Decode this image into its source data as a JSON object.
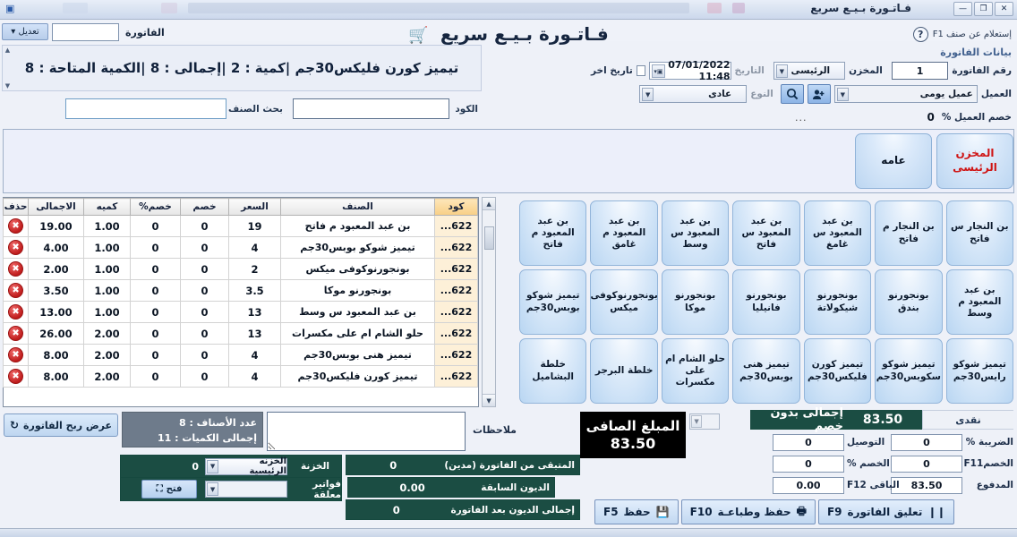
{
  "window": {
    "title": "فـاتـورة بـيـع سريع",
    "minimize": "—",
    "maximize": "❐",
    "close": "✕"
  },
  "topbar": {
    "invoice_label": "الفاتورة",
    "invoice_value": "",
    "edit_button": "تعديل ▾"
  },
  "header": {
    "help_label": "إستعلام عن صنف F1",
    "help_icon": "?",
    "section_title": "بيانات الفاتورة",
    "invoice_no_label": "رقم الفاتورة",
    "invoice_no_value": "1",
    "store_label": "المخزن",
    "store_value": "الرئيسى",
    "date_label": "التاريخ",
    "date_value": "07/01/2022 11:48",
    "other_date_label": "تاريخ اخر",
    "other_date_checked": false,
    "customer_label": "العميل",
    "customer_value": "عميل يومى",
    "customer_search_icon": "search-icon",
    "customer_add_icon": "add-user-icon",
    "type_label": "النوع",
    "type_value": "عادى",
    "customer_discount_label": "خصم العميل %",
    "customer_discount_value": "0",
    "dots": "..."
  },
  "item_banner": {
    "text": "تيميز كورن فليكس30جم  |كمية : 2  |إجمالى : 8  |الكمية المتاحة : 8"
  },
  "search_row": {
    "code_label": "الكود",
    "code_value": "",
    "search_label": "بحث الصنف",
    "search_value": ""
  },
  "category_tabs": [
    {
      "label": "عامه",
      "accent": "#0b1626"
    },
    {
      "label": "المخزن الرئيسى",
      "accent": "#cf1414"
    }
  ],
  "items_table": {
    "columns": [
      "كود",
      "الصنف",
      "السعر",
      "خصم",
      "خصم%",
      "كميه",
      "الاجمالى",
      "حذف"
    ],
    "delete_glyph": "✖",
    "rows": [
      {
        "code": "622...",
        "name": "بن عبد المعبود م فاتح",
        "price": "19",
        "disc": "0",
        "disc_pct": "0",
        "qty": "1.00",
        "total": "19.00"
      },
      {
        "code": "622...",
        "name": "تيميز شوكو بوبس30جم",
        "price": "4",
        "disc": "0",
        "disc_pct": "0",
        "qty": "1.00",
        "total": "4.00"
      },
      {
        "code": "622...",
        "name": "بونجورنوكوفى ميكس",
        "price": "2",
        "disc": "0",
        "disc_pct": "0",
        "qty": "1.00",
        "total": "2.00"
      },
      {
        "code": "622...",
        "name": "بونجورنو موكا",
        "price": "3.5",
        "disc": "0",
        "disc_pct": "0",
        "qty": "1.00",
        "total": "3.50"
      },
      {
        "code": "622...",
        "name": "بن عبد المعبود س وسط",
        "price": "13",
        "disc": "0",
        "disc_pct": "0",
        "qty": "1.00",
        "total": "13.00"
      },
      {
        "code": "622...",
        "name": "حلو الشام ام على مكسرات",
        "price": "13",
        "disc": "0",
        "disc_pct": "0",
        "qty": "2.00",
        "total": "26.00"
      },
      {
        "code": "622...",
        "name": "تيميز هنى بوبس30جم",
        "price": "4",
        "disc": "0",
        "disc_pct": "0",
        "qty": "2.00",
        "total": "8.00"
      },
      {
        "code": "622...",
        "name": "تيميز كورن فليكس30جم",
        "price": "4",
        "disc": "0",
        "disc_pct": "0",
        "qty": "2.00",
        "total": "8.00"
      }
    ]
  },
  "product_buttons": [
    "بن النجار س فاتح",
    "بن النجار م فاتح",
    "بن عبد المعبود س غامغ",
    "بن عبد المعبود س فاتح",
    "بن عبد المعبود س وسط",
    "بن عبد المعبود م غامق",
    "بن عبد المعبود م فاتح",
    "بن عبد المعبود م وسط",
    "بونجورنو بندق",
    "بونجورنو شيكولاتة",
    "بونجورنو فانيليا",
    "بونجورنو موكا",
    "بونجورنوكوفى ميكس",
    "تيميز شوكو بوبس30جم",
    "تيميز شوكو رايس30جم",
    "تيميز شوكو سكوبس30جم",
    "تيميز كورن فليكس30جم",
    "تيميز هنى بوبس30جم",
    "حلو الشام ام على مكسرات",
    "خلطة البرجر",
    "خلطة البشاميل"
  ],
  "footer_left": {
    "profit_button": "عرض ربح الفاتورة",
    "refresh_icon": "refresh-icon",
    "items_count_label": "عدد الأصناف :",
    "items_count_value": "8",
    "qty_total_label": "إجمالى الكميات :",
    "qty_total_value": "11",
    "notes_label": "ملاحظات",
    "notes_value": ""
  },
  "treasury": {
    "treasury_label": "الخزنة",
    "treasury_value": "الخزنه الرئيسية",
    "treasury_amount": "0",
    "pending_label": "فواتير معلقة",
    "pending_value": "",
    "open_button": "فتح",
    "open_icon": "expand-icon"
  },
  "debts": {
    "remaining_label": "المتبقى من الفاتورة (مدين)",
    "remaining_value": "0",
    "previous_label": "الديون السابقة",
    "previous_value": "0.00",
    "after_label": "إجمالى الديون بعد الفاتورة",
    "after_value": "0"
  },
  "net": {
    "label": "المبلغ الصافى",
    "value": "83.50"
  },
  "totals": {
    "gross_label": "إجمالى بدون خصم",
    "gross_value": "83.50",
    "payment_method": "نقدى",
    "tax_label": "الضريبة %",
    "tax_value": "0",
    "delivery_label": "التوصيل",
    "delivery_value": "0",
    "discount_label": "الخصمF11",
    "discount_value": "0",
    "discount_checked": true,
    "discount_pct_label": "الخصم %",
    "discount_pct_value": "0",
    "paid_label": "المدفوع",
    "paid_value": "83.50",
    "change_label": "الباقى F12",
    "change_value": "0.00"
  },
  "fkeys": [
    {
      "key": "F5",
      "label": "حفظ",
      "icon": "save-icon",
      "glyph": "💾"
    },
    {
      "key": "F10",
      "label": "حفظ وطباعـة",
      "icon": "print-icon",
      "glyph": "🖶"
    },
    {
      "key": "F9",
      "label": "تعليق الفاتورة",
      "icon": "pause-icon",
      "glyph": "❙❙"
    }
  ]
}
